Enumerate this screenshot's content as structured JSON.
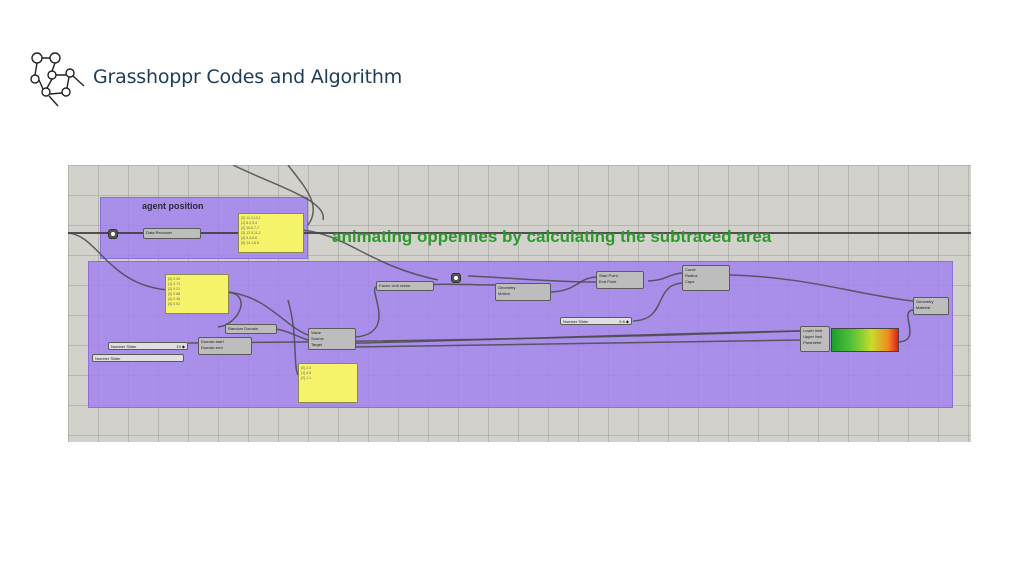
{
  "slide": {
    "title": "Grasshoppr Codes and Algorithm"
  },
  "canvas": {
    "group_agent_label": "agent position",
    "annotation": "animating oppennes by calculating the subtraced area",
    "components": {
      "data_recorder": "Data Recorder",
      "random": "Random",
      "domain": "Domain",
      "domain_start": "Domain start",
      "domain_end": "Domain end",
      "domain2": "Domain",
      "value": "Value",
      "source": "Source",
      "target": "Target",
      "mapped": "Mapped",
      "clipped": "Clipped",
      "factor": "Factor",
      "unit_vector": "Unit vector",
      "geometry": "Geometry",
      "motion": "Motion",
      "geometry_out": "Geometry",
      "transform": "Transform",
      "start_point": "Start Point",
      "end_point": "End Point",
      "line": "Line",
      "curve": "Curve",
      "radius": "Radius",
      "caps": "Caps",
      "pipe": "Pipe",
      "lower_limit": "Lower limit",
      "upper_limit": "Upper limit",
      "parameter": "Parameter",
      "geometry_preview": "Geometry",
      "material": "Material"
    },
    "sliders": {
      "slider1_label": "Number Slider",
      "slider1_value": "10 ◆",
      "slider2_label": "Number Slider",
      "slider2_value": "",
      "slider3_label": "Number Slider",
      "slider3_value": "0.6 ◆"
    }
  }
}
